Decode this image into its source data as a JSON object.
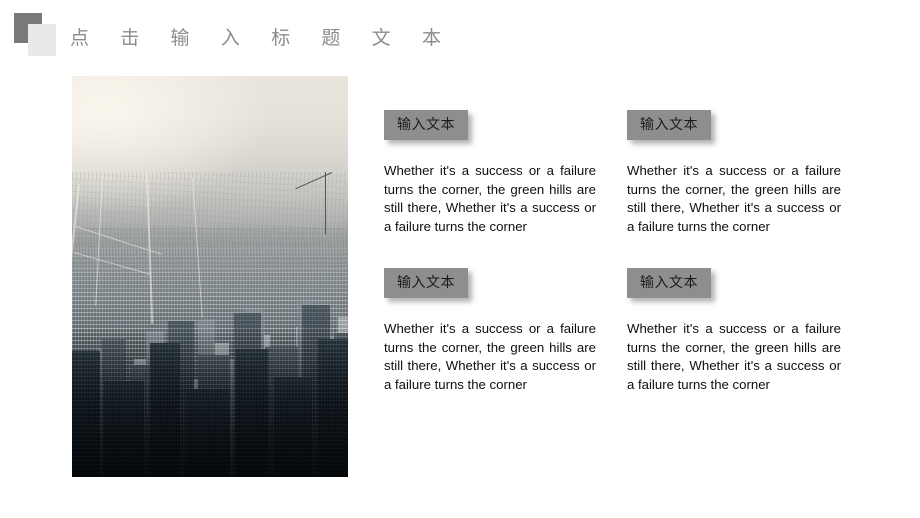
{
  "slide": {
    "background_color": "#ffffff",
    "title": "点 击 输 入 标 题 文 本",
    "title_color": "#8c8c8c"
  },
  "logo": {
    "dark_square_color": "#7a7a7a",
    "light_square_color": "#e9e9e9",
    "name": "overlapping-squares-logo"
  },
  "photo": {
    "alt": "Aerial view of a dense city skyline with skyscrapers fading into hazy sky",
    "accent_color": "#4e585d"
  },
  "cards": [
    {
      "badge": "输入文本",
      "body": "Whether it's a success or a failure turns the corner, the green hills are still there, Whether it's a success or a failure turns the corner"
    },
    {
      "badge": "输入文本",
      "body": "Whether it's a success or a failure turns the corner, the green hills are still there, Whether it's a success or a failure turns the corner"
    },
    {
      "badge": "输入文本",
      "body": "Whether it's a success or a failure turns the corner, the green hills are still there, Whether it's a success or a failure turns the corner"
    },
    {
      "badge": "输入文本",
      "body": "Whether it's a success or a failure turns the corner, the green hills are still there, Whether it's a success or a failure turns the corner"
    }
  ],
  "theme": {
    "badge_bg": "#8e8e8e",
    "badge_text": "#1c1c1c",
    "body_text": "#0f0f0f"
  }
}
